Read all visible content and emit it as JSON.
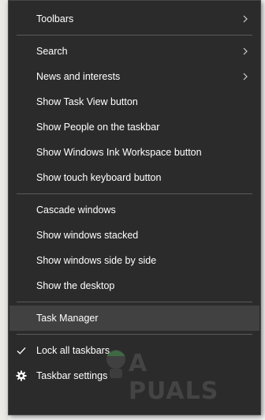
{
  "menu": {
    "group1": [
      {
        "label": "Toolbars",
        "submenu": true
      }
    ],
    "group2": [
      {
        "label": "Search",
        "submenu": true
      },
      {
        "label": "News and interests",
        "submenu": true
      },
      {
        "label": "Show Task View button"
      },
      {
        "label": "Show People on the taskbar"
      },
      {
        "label": "Show Windows Ink Workspace button"
      },
      {
        "label": "Show touch keyboard button"
      }
    ],
    "group3": [
      {
        "label": "Cascade windows"
      },
      {
        "label": "Show windows stacked"
      },
      {
        "label": "Show windows side by side"
      },
      {
        "label": "Show the desktop"
      }
    ],
    "group4": [
      {
        "label": "Task Manager",
        "hovered": true
      }
    ],
    "group5": [
      {
        "label": "Lock all taskbars",
        "icon": "checkmark-icon",
        "checked": true
      },
      {
        "label": "Taskbar settings",
        "icon": "gear-icon"
      }
    ]
  },
  "watermark": {
    "text": "A PUALS"
  },
  "colors": {
    "menu_bg": "#2b2b2b",
    "hover_bg": "#414141",
    "text": "#ffffff",
    "separator": "#5a5a5a"
  }
}
